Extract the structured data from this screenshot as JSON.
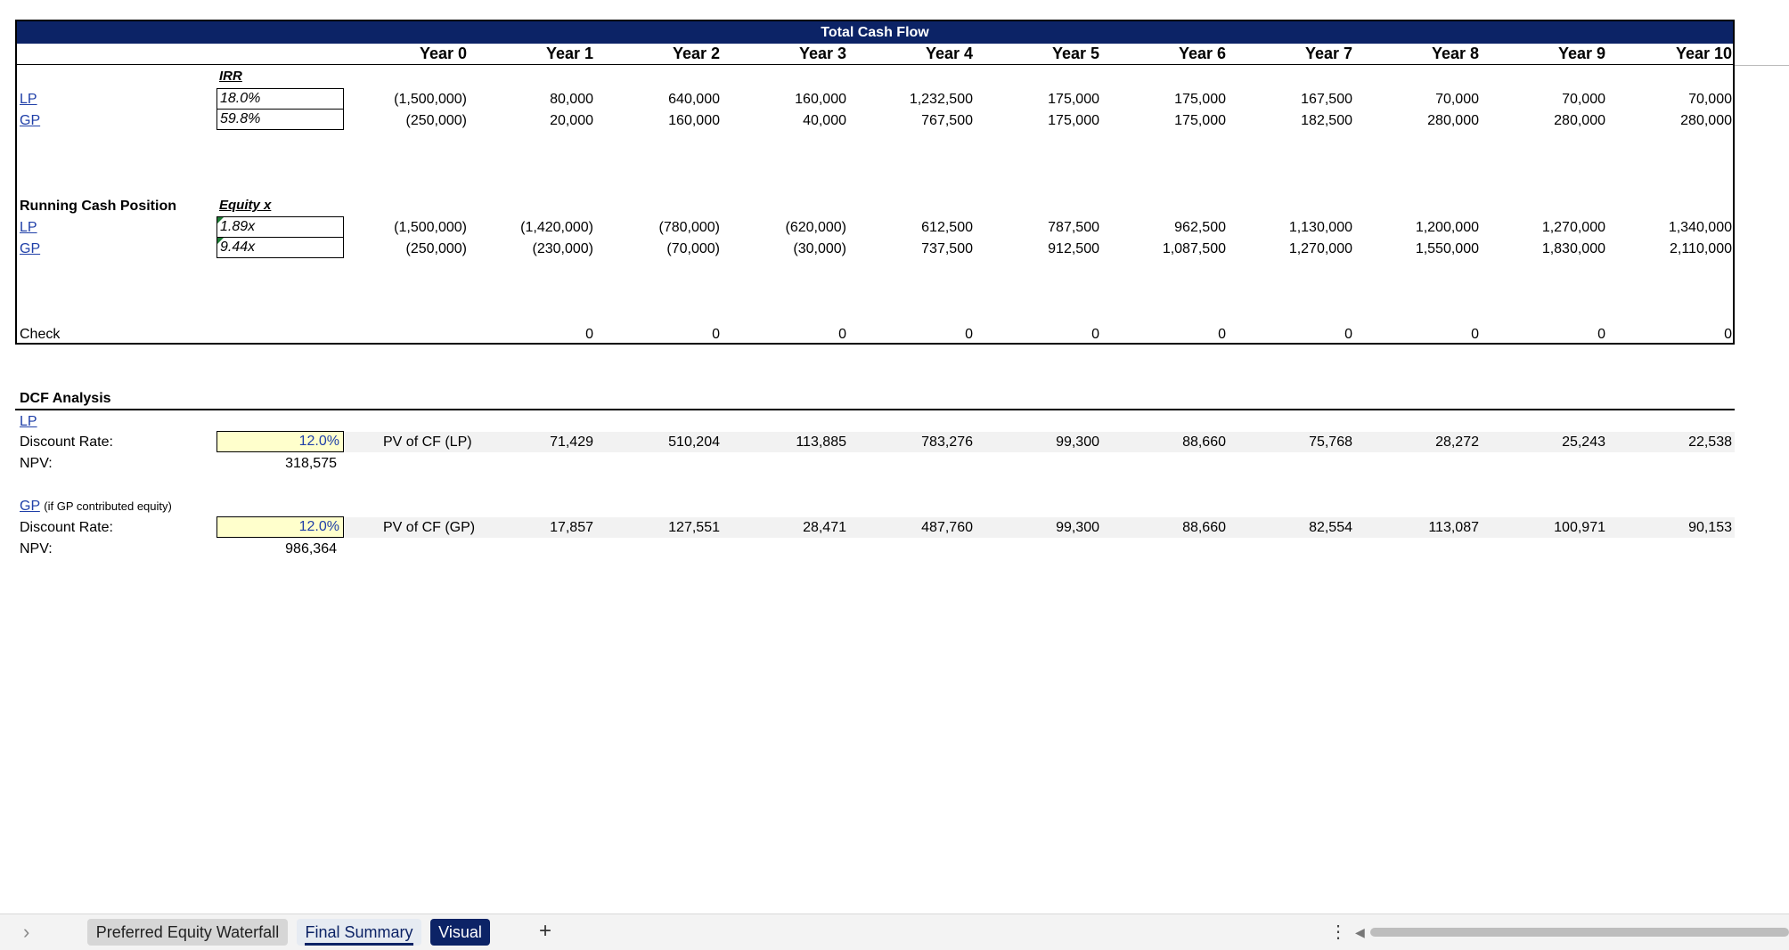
{
  "table": {
    "title": "Total Cash Flow",
    "years": [
      "Year 0",
      "Year 1",
      "Year 2",
      "Year 3",
      "Year 4",
      "Year 5",
      "Year 6",
      "Year 7",
      "Year 8",
      "Year 9",
      "Year 10"
    ],
    "irr_label": "IRR",
    "lp_label": "LP",
    "gp_label": "GP",
    "lp_irr": "18.0%",
    "gp_irr": "59.8%",
    "lp_cf": [
      "(1,500,000)",
      "80,000",
      "640,000",
      "160,000",
      "1,232,500",
      "175,000",
      "175,000",
      "167,500",
      "70,000",
      "70,000",
      "70,000"
    ],
    "gp_cf": [
      "(250,000)",
      "20,000",
      "160,000",
      "40,000",
      "767,500",
      "175,000",
      "175,000",
      "182,500",
      "280,000",
      "280,000",
      "280,000"
    ],
    "running_label": "Running Cash Position",
    "equity_label": "Equity x",
    "lp_equity": "1.89x",
    "gp_equity": "9.44x",
    "lp_running": [
      "(1,500,000)",
      "(1,420,000)",
      "(780,000)",
      "(620,000)",
      "612,500",
      "787,500",
      "962,500",
      "1,130,000",
      "1,200,000",
      "1,270,000",
      "1,340,000"
    ],
    "gp_running": [
      "(250,000)",
      "(230,000)",
      "(70,000)",
      "(30,000)",
      "737,500",
      "912,500",
      "1,087,500",
      "1,270,000",
      "1,550,000",
      "1,830,000",
      "2,110,000"
    ],
    "check_label": "Check",
    "check": [
      "0",
      "0",
      "0",
      "0",
      "0",
      "0",
      "0",
      "0",
      "0",
      "0"
    ]
  },
  "dcf": {
    "title": "DCF Analysis",
    "lp_label": "LP",
    "discount_label": "Discount Rate:",
    "npv_label": "NPV:",
    "lp_rate": "12.0%",
    "lp_npv": "318,575",
    "lp_pv_label": "PV of CF (LP)",
    "lp_pv": [
      "71,429",
      "510,204",
      "113,885",
      "783,276",
      "99,300",
      "88,660",
      "75,768",
      "28,272",
      "25,243",
      "22,538"
    ],
    "gp_label": "GP",
    "gp_note": "(if GP contributed equity)",
    "gp_rate": "12.0%",
    "gp_npv": "986,364",
    "gp_pv_label": "PV of CF (GP)",
    "gp_pv": [
      "17,857",
      "127,551",
      "28,471",
      "487,760",
      "99,300",
      "88,660",
      "82,554",
      "113,087",
      "100,971",
      "90,153"
    ]
  },
  "sheet_tabs": {
    "nav_prev": "›",
    "tabs": [
      "Preferred Equity Waterfall",
      "Final Summary",
      "Visual"
    ],
    "active": "Final Summary",
    "add": "+",
    "more": "⋮",
    "scroll_left": "◀"
  },
  "colors": {
    "header_navy": "#0c2366",
    "input_yellow": "#ffffcc",
    "input_blue": "#1f3fa8"
  }
}
